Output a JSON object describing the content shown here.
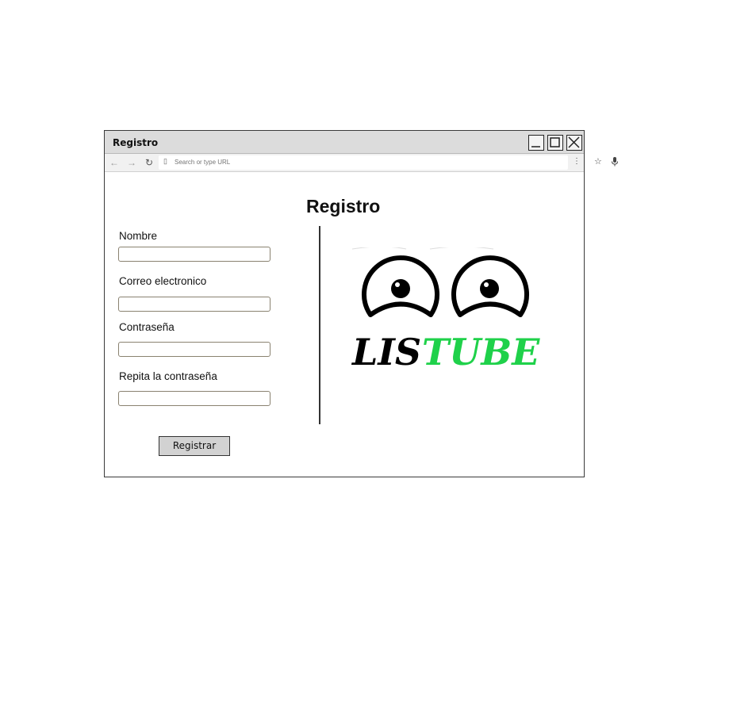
{
  "window": {
    "title": "Registro"
  },
  "browser": {
    "url_placeholder": "Search or type URL"
  },
  "form": {
    "heading": "Registro",
    "fields": [
      {
        "label": "Nombre",
        "value": ""
      },
      {
        "label": "Correo electronico",
        "value": ""
      },
      {
        "label": "Contraseña",
        "value": ""
      },
      {
        "label": "Repita la contraseña",
        "value": ""
      }
    ],
    "submit_label": "Registrar"
  },
  "logo": {
    "text_dark": "LIS",
    "text_accent": "TUBE",
    "accent_color": "#1fd14a",
    "dark_color": "#000000"
  },
  "icons": {
    "minimize": "minimize-icon",
    "maximize": "maximize-icon",
    "close": "close-icon",
    "back": "arrow-left-icon",
    "forward": "arrow-right-icon",
    "reload": "reload-icon",
    "page": "page-icon",
    "star": "star-icon",
    "mic": "microphone-icon",
    "menu": "kebab-menu-icon"
  }
}
